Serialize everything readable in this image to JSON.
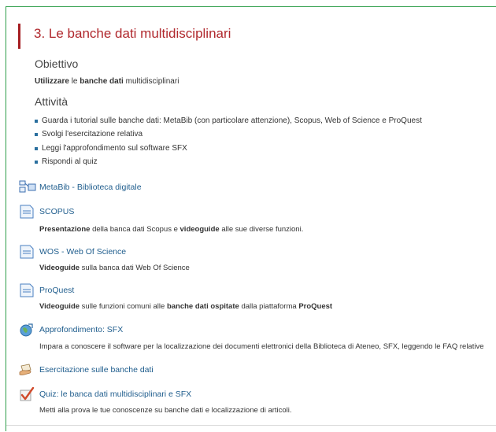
{
  "section": {
    "title": "3. Le banche dati multidisciplinari"
  },
  "objective": {
    "heading": "Obiettivo",
    "text_bold1": "Utilizzare",
    "text_mid": "le",
    "text_bold2": "banche dati",
    "text_end": "multidisciplinari"
  },
  "activities": {
    "heading": "Attività",
    "items": [
      "Guarda i tutorial sulle banche dati:  MetaBib (con particolare attenzione), Scopus, Web of Science e ProQuest",
      "Svolgi l'esercitazione relativa",
      "Leggi l'approfondimento sul software SFX",
      "Rispondi al quiz"
    ]
  },
  "resources": [
    {
      "label": "MetaBib - Biblioteca digitale",
      "icon": "folder-icon"
    },
    {
      "label": "SCOPUS",
      "icon": "page-icon",
      "desc": {
        "b1": "Presentazione",
        "t1": "della banca dati Scopus e",
        "b2": "videoguide",
        "t2": "alle sue diverse funzioni."
      }
    },
    {
      "label": "WOS - Web Of Science",
      "icon": "page-icon",
      "desc": {
        "b1": "Videoguide",
        "t1": "sulla banca dati Web Of Science"
      }
    },
    {
      "label": "ProQuest",
      "icon": "page-icon",
      "desc": {
        "b1": "Videoguide",
        "t1": "sulle funzioni comuni alle",
        "b2": "banche dati ospitate",
        "t2": "dalla piattaforma",
        "b3": "ProQuest"
      }
    },
    {
      "label": "Approfondimento: SFX",
      "icon": "globe-url-icon",
      "desc": {
        "t1": "Impara a conoscere il software per la localizzazione dei documenti elettronici della Biblioteca di Ateneo, SFX, leggendo le FAQ relative"
      }
    },
    {
      "label": "Esercitazione sulle banche dati",
      "icon": "hand-assignment-icon"
    },
    {
      "label": "Quiz: le banca dati multidisciplinari e SFX",
      "icon": "quiz-check-icon",
      "desc": {
        "t1": "Metti alla prova le tue conoscenze su banche dati e localizzazione di articoli."
      }
    }
  ],
  "colors": {
    "accent_bar": "#a51e22",
    "title": "#b0282d",
    "link": "#1f5d8d",
    "frame": "#2e9e4a"
  }
}
